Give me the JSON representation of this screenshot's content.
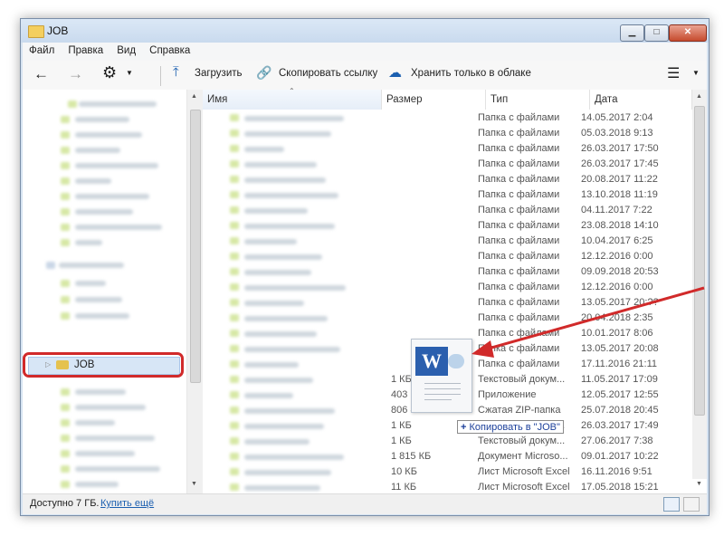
{
  "window": {
    "title": "JOB"
  },
  "menu": [
    "Файл",
    "Правка",
    "Вид",
    "Справка"
  ],
  "toolbar": {
    "upload": "Загрузить",
    "copy_link": "Скопировать ссылку",
    "cloud_only": "Хранить только в облаке"
  },
  "columns": {
    "name": "Имя",
    "size": "Размер",
    "type": "Тип",
    "date": "Дата"
  },
  "nav": {
    "job_label": "JOB"
  },
  "rows": [
    {
      "size": "",
      "type": "Папка с файлами",
      "date": "14.05.2017 2:04"
    },
    {
      "size": "",
      "type": "Папка с файлами",
      "date": "05.03.2018 9:13"
    },
    {
      "size": "",
      "type": "Папка с файлами",
      "date": "26.03.2017 17:50"
    },
    {
      "size": "",
      "type": "Папка с файлами",
      "date": "26.03.2017 17:45"
    },
    {
      "size": "",
      "type": "Папка с файлами",
      "date": "20.08.2017 11:22"
    },
    {
      "size": "",
      "type": "Папка с файлами",
      "date": "13.10.2018 11:19"
    },
    {
      "size": "",
      "type": "Папка с файлами",
      "date": "04.11.2017 7:22"
    },
    {
      "size": "",
      "type": "Папка с файлами",
      "date": "23.08.2018 14:10"
    },
    {
      "size": "",
      "type": "Папка с файлами",
      "date": "10.04.2017 6:25"
    },
    {
      "size": "",
      "type": "Папка с файлами",
      "date": "12.12.2016 0:00"
    },
    {
      "size": "",
      "type": "Папка с файлами",
      "date": "09.09.2018 20:53"
    },
    {
      "size": "",
      "type": "Папка с файлами",
      "date": "12.12.2016 0:00"
    },
    {
      "size": "",
      "type": "Папка с файлами",
      "date": "13.05.2017 20:??"
    },
    {
      "size": "",
      "type": "Папка с файлами",
      "date": "20.04.2018 2:35"
    },
    {
      "size": "",
      "type": "Папка с файлами",
      "date": "10.01.2017 8:06"
    },
    {
      "size": "",
      "type": "Папка с файлами",
      "date": "13.05.2017 20:08"
    },
    {
      "size": "",
      "type": "Папка с файлами",
      "date": "17.11.2016 21:11"
    },
    {
      "size": "1 КБ",
      "type": "Текстовый докум...",
      "date": "11.05.2017 17:09"
    },
    {
      "size": "403 КБ",
      "type": "Приложение",
      "date": "12.05.2017 12:55"
    },
    {
      "size": "806 817 КБ",
      "type": "Сжатая ZIP-папка",
      "date": "25.07.2018 20:45"
    },
    {
      "size": "1 КБ",
      "type": "Текстовый докум...",
      "date": "26.03.2017 17:49"
    },
    {
      "size": "1 КБ",
      "type": "Текстовый докум...",
      "date": "27.06.2017 7:38"
    },
    {
      "size": "1 815 КБ",
      "type": "Документ Microso...",
      "date": "09.01.2017 10:22"
    },
    {
      "size": "10 КБ",
      "type": "Лист Microsoft Excel",
      "date": "16.11.2016 9:51"
    },
    {
      "size": "11 КБ",
      "type": "Лист Microsoft Excel",
      "date": "17.05.2018 15:21"
    }
  ],
  "drag": {
    "tooltip_plus": "+",
    "tooltip": "Копировать в \"JOB\""
  },
  "status": {
    "available": "Доступно 7 ГБ.",
    "buy_more": "Купить ещё"
  },
  "colors": {
    "highlight": "#d12a2a",
    "accent": "#1b5fb0"
  }
}
